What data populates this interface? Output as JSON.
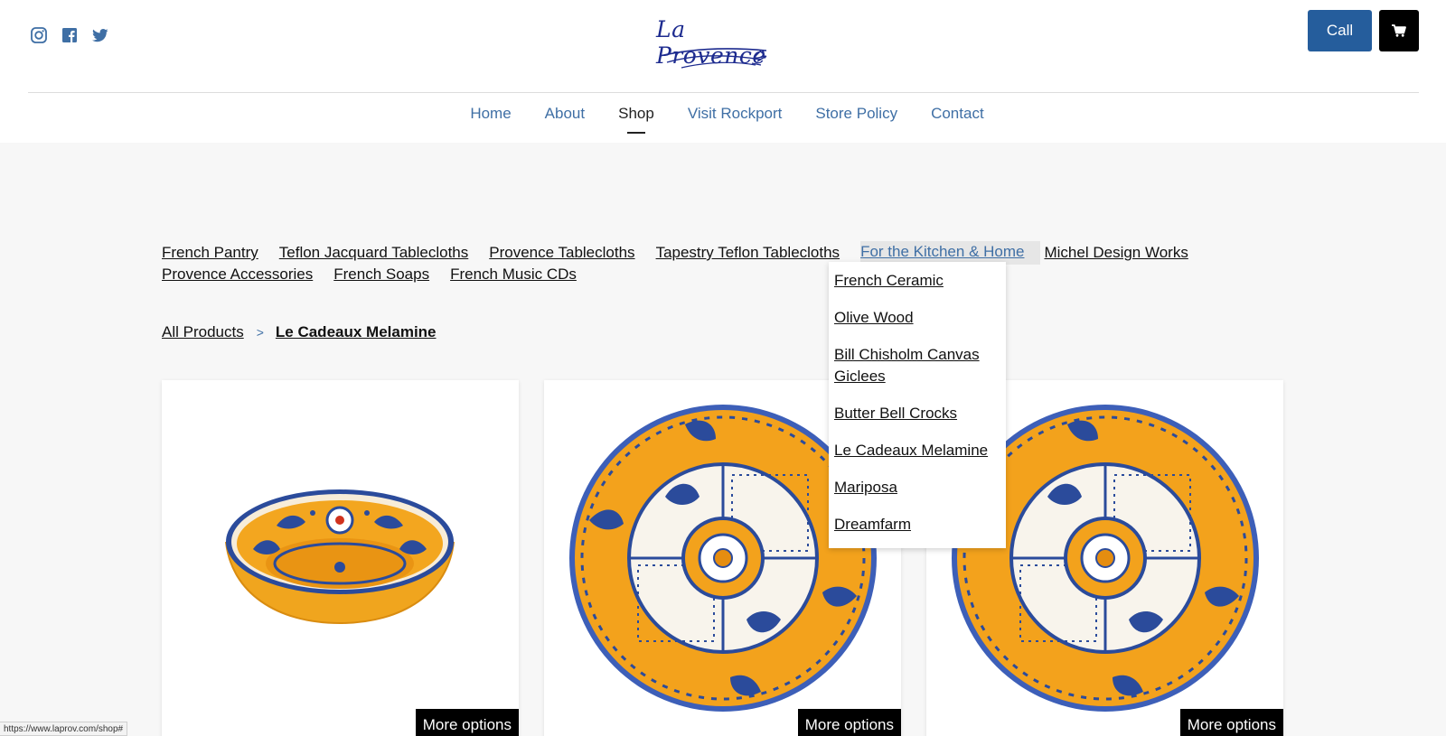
{
  "header": {
    "social_icons": [
      "instagram-icon",
      "facebook-icon",
      "twitter-icon"
    ],
    "logo_text": "La Provence",
    "call_label": "Call",
    "cart_icon": "cart-icon",
    "accent_color": "#255d9c"
  },
  "main_nav": {
    "items": [
      {
        "label": "Home"
      },
      {
        "label": "About"
      },
      {
        "label": "Shop"
      },
      {
        "label": "Visit Rockport"
      },
      {
        "label": "Store Policy"
      },
      {
        "label": "Contact"
      }
    ],
    "active": "Shop"
  },
  "category_nav": {
    "row1": [
      "French Pantry",
      "Teflon Jacquard Tablecloths",
      "Provence Tablecloths",
      "Tapestry Teflon Tablecloths",
      "For the Kitchen & Home",
      "Michel Design Works"
    ],
    "row2": [
      "Provence Accessories",
      "French Soaps",
      "French Music CDs"
    ],
    "active": "For the Kitchen & Home"
  },
  "dropdown": {
    "items": [
      "French Ceramic",
      "Olive Wood",
      "Bill Chisholm Canvas Giclees",
      "Butter Bell Crocks",
      "Le Cadeaux Melamine",
      "Mariposa",
      "Dreamfarm"
    ]
  },
  "breadcrumb": {
    "root": "All Products",
    "separator": ">",
    "current": "Le Cadeaux Melamine"
  },
  "products": [
    {
      "image": "yellow-blue-melamine-bowl",
      "button_label": "More options"
    },
    {
      "image": "yellow-blue-melamine-plate",
      "button_label": "More options"
    },
    {
      "image": "yellow-blue-melamine-plate",
      "button_label": "More options"
    }
  ],
  "status_bar": {
    "url": "https://www.laprov.com/shop#"
  }
}
